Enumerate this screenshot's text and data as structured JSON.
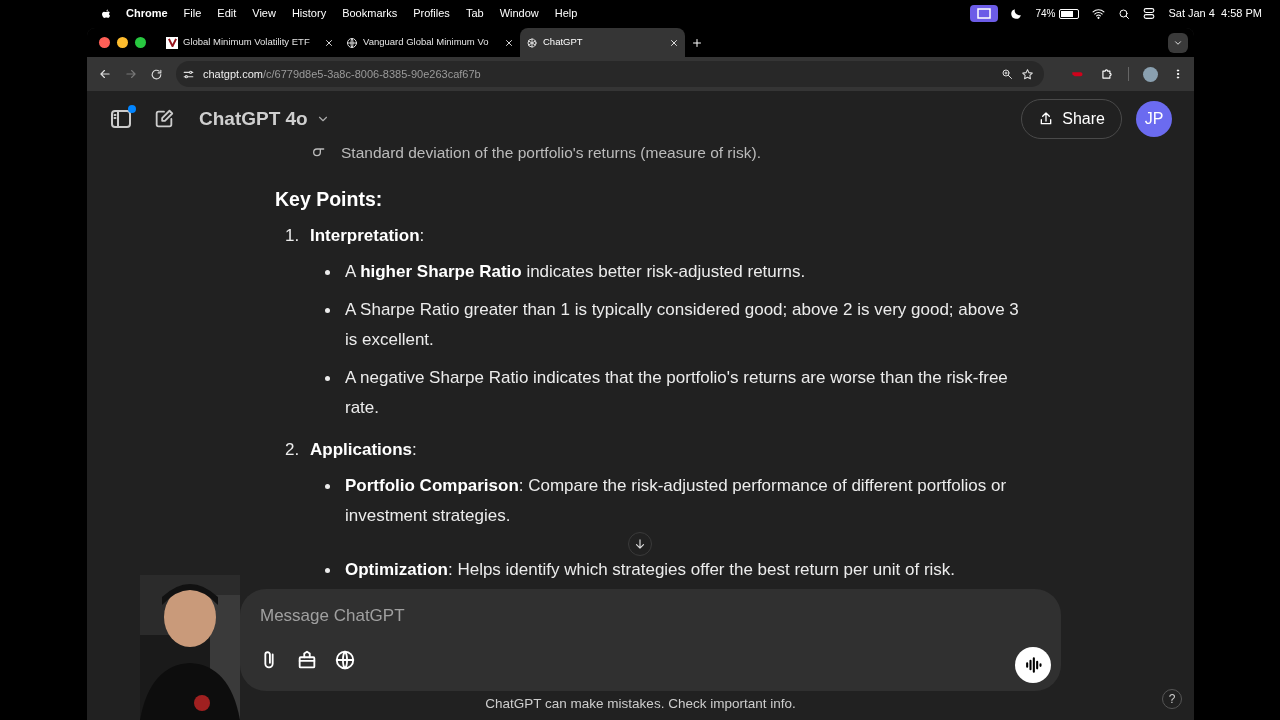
{
  "menu_bar": {
    "app": "Chrome",
    "items": [
      "File",
      "Edit",
      "View",
      "History",
      "Bookmarks",
      "Profiles",
      "Tab",
      "Window",
      "Help"
    ],
    "battery": "74%",
    "clock": "Sat Jan 4  4:58 PM"
  },
  "tabs": [
    {
      "title": "Global Minimum Volatility ETF",
      "selected": false,
      "kind": "vanguard"
    },
    {
      "title": "Vanguard Global Minimum Vo",
      "selected": false,
      "kind": "globe"
    },
    {
      "title": "ChatGPT",
      "selected": true,
      "kind": "chatgpt"
    }
  ],
  "address_bar": {
    "domain": "chatgpt.com",
    "path": "/c/6779d8e5-3a8c-8006-8385-90e263caf67b"
  },
  "header": {
    "model": "ChatGPT 4o",
    "share": "Share",
    "avatar": "JP"
  },
  "message": {
    "definition": "Standard deviation of the portfolio's returns (measure of risk).",
    "heading": "Key Points:",
    "sections": [
      {
        "number": "1.",
        "title": "**Interpretation**:",
        "bullets": [
          "A **higher Sharpe Ratio** indicates better risk-adjusted returns.",
          "A Sharpe Ratio greater than 1 is typically considered good; above 2 is very good; above 3 is excellent.",
          "A negative Sharpe Ratio indicates that the portfolio's returns are worse than the risk-free rate."
        ]
      },
      {
        "number": "2.",
        "title": "**Applications**:",
        "bullets": [
          "**Portfolio Comparison**: Compare the risk-adjusted performance of different portfolios or investment strategies.",
          "**Optimization**: Helps identify which strategies offer the best return per unit of risk."
        ]
      }
    ]
  },
  "composer": {
    "placeholder": "Message ChatGPT"
  },
  "footer": "ChatGPT can make mistakes. Check important info.",
  "help": "?"
}
